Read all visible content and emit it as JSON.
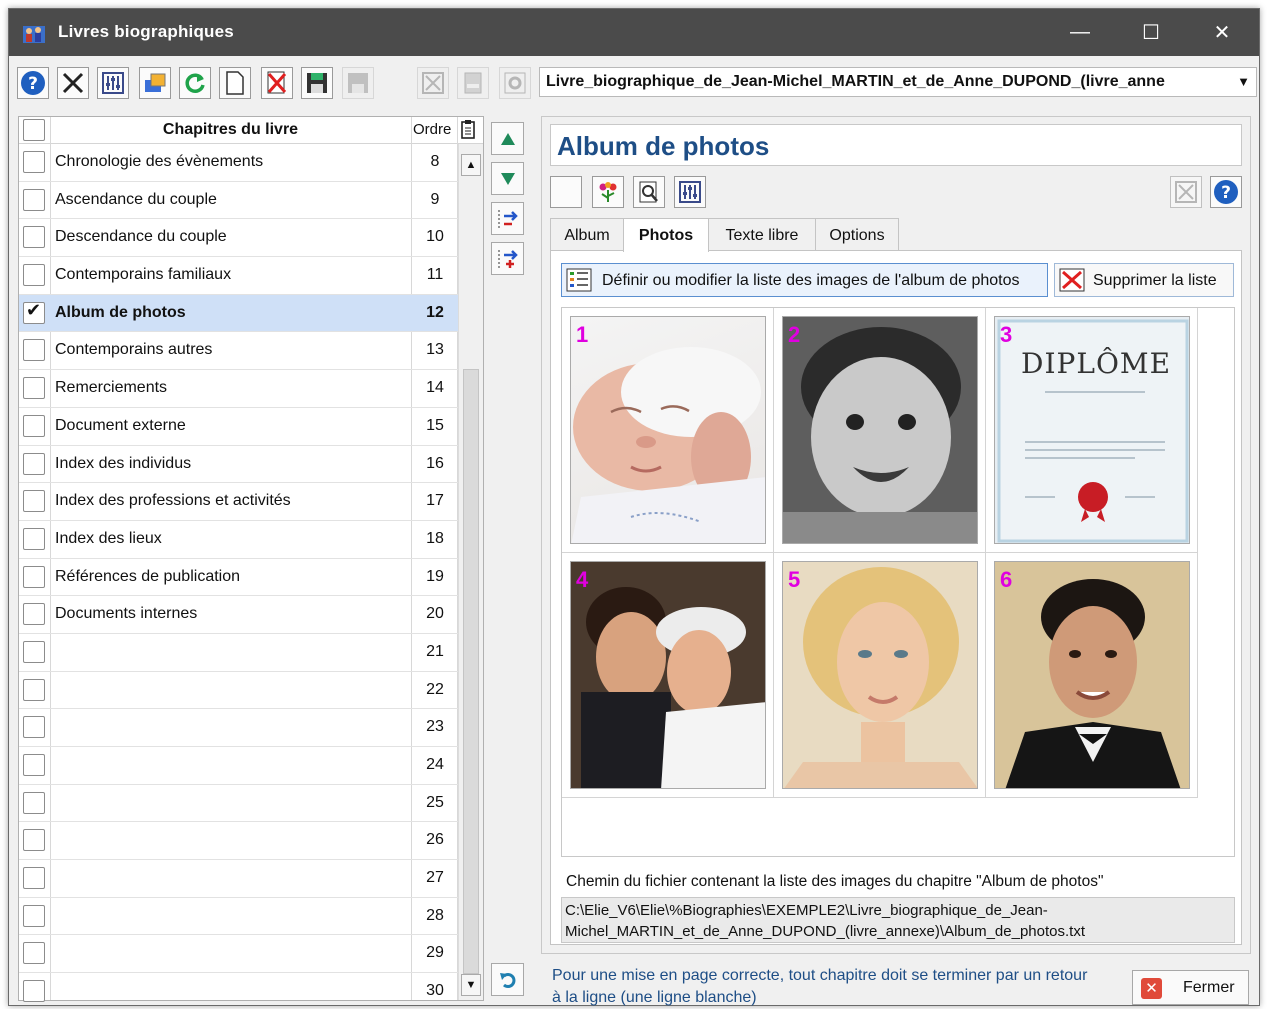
{
  "window": {
    "title": "Livres biographiques",
    "minimize": "—",
    "maximize": "☐",
    "close": "✕"
  },
  "toolbar": {
    "buttons": [
      "help-icon",
      "tools-icon",
      "settings-icon",
      "print-icon",
      "refresh-icon",
      "new-document-icon",
      "delete-icon",
      "save-icon",
      "save-disabled-icon",
      "clear-disabled-icon",
      "window-disabled-icon",
      "gear-disabled-icon"
    ],
    "book_selected": "Livre_biographique_de_Jean-Michel_MARTIN_et_de_Anne_DUPOND_(livre_anne"
  },
  "chapters": {
    "header_title": "Chapitres du livre",
    "header_order": "Ordre",
    "rows": [
      {
        "label": "Chronologie des évènements",
        "ordre": "8",
        "checked": false
      },
      {
        "label": "Ascendance du couple",
        "ordre": "9",
        "checked": false
      },
      {
        "label": "Descendance du couple",
        "ordre": "10",
        "checked": false
      },
      {
        "label": "Contemporains familiaux",
        "ordre": "11",
        "checked": false
      },
      {
        "label": "Album de photos",
        "ordre": "12",
        "checked": true
      },
      {
        "label": "Contemporains autres",
        "ordre": "13",
        "checked": false
      },
      {
        "label": "Remerciements",
        "ordre": "14",
        "checked": false
      },
      {
        "label": "Document externe",
        "ordre": "15",
        "checked": false
      },
      {
        "label": "Index des individus",
        "ordre": "16",
        "checked": false
      },
      {
        "label": "Index des professions et activités",
        "ordre": "17",
        "checked": false
      },
      {
        "label": "Index des lieux",
        "ordre": "18",
        "checked": false
      },
      {
        "label": "Références de publication",
        "ordre": "19",
        "checked": false
      },
      {
        "label": "Documents internes",
        "ordre": "20",
        "checked": false
      },
      {
        "label": "",
        "ordre": "21",
        "checked": false
      },
      {
        "label": "",
        "ordre": "22",
        "checked": false
      },
      {
        "label": "",
        "ordre": "23",
        "checked": false
      },
      {
        "label": "",
        "ordre": "24",
        "checked": false
      },
      {
        "label": "",
        "ordre": "25",
        "checked": false
      },
      {
        "label": "",
        "ordre": "26",
        "checked": false
      },
      {
        "label": "",
        "ordre": "27",
        "checked": false
      },
      {
        "label": "",
        "ordre": "28",
        "checked": false
      },
      {
        "label": "",
        "ordre": "29",
        "checked": false
      },
      {
        "label": "",
        "ordre": "30",
        "checked": false
      }
    ]
  },
  "album": {
    "title": "Album de photos",
    "tabs": [
      "Album",
      "Photos",
      "Texte libre",
      "Options"
    ],
    "active_tab": "Photos",
    "define_button": "Définir ou modifier la liste des images de l'album de photos",
    "delete_button": "Supprimer la liste",
    "photos": [
      {
        "num": "1",
        "subject": "newborn baby"
      },
      {
        "num": "2",
        "subject": "smiling toddler"
      },
      {
        "num": "3",
        "subject": "diploma",
        "text": "DIPLÔME"
      },
      {
        "num": "4",
        "subject": "wedding couple"
      },
      {
        "num": "5",
        "subject": "blonde woman"
      },
      {
        "num": "6",
        "subject": "man in tuxedo"
      }
    ],
    "path_label": "Chemin du fichier contenant la liste des images du chapitre \"Album de photos\"",
    "path_value": "C:\\Elie_V6\\Elie\\%Biographies\\EXEMPLE2\\Livre_biographique_de_Jean-Michel_MARTIN_et_de_Anne_DUPOND_(livre_annexe)\\Album_de_photos.txt"
  },
  "footer": {
    "note": "Pour une mise en page correcte, tout chapitre doit se terminer par un retour à la ligne (une ligne blanche)",
    "close_label": "Fermer"
  },
  "colors": {
    "title_blue": "#1e4e86",
    "selection": "#cfe0f7",
    "photo_number": "#e000e0"
  }
}
